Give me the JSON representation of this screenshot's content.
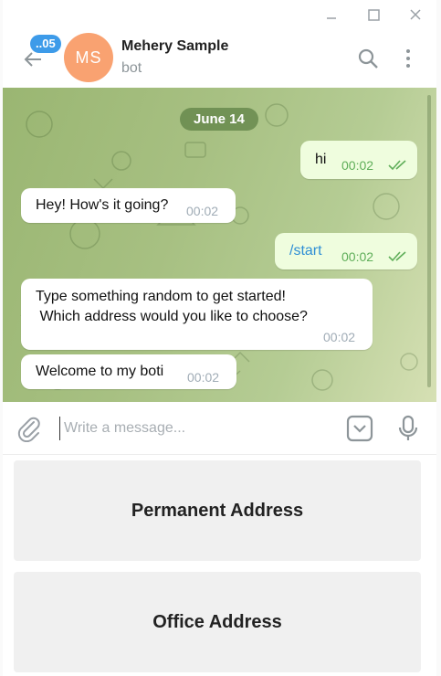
{
  "window": {
    "controls": {
      "minimize_icon": "minimize-icon",
      "maximize_icon": "maximize-icon",
      "close_icon": "close-icon"
    }
  },
  "header": {
    "unread_count": "..05",
    "avatar_initials": "MS",
    "avatar_color": "#f9a271",
    "title": "Mehery Sample",
    "status": "bot"
  },
  "chat": {
    "date": "June 14",
    "messages": [
      {
        "direction": "out",
        "text": "hi",
        "time": "00:02",
        "read": true
      },
      {
        "direction": "in",
        "text": "Hey! How's it going?",
        "time": "00:02"
      },
      {
        "direction": "out",
        "text": "/start",
        "time": "00:02",
        "read": true
      },
      {
        "direction": "in",
        "line1": "Type something random to get started!",
        "line2": " Which address would you like to choose?",
        "time": "00:02"
      },
      {
        "direction": "in",
        "text": "Welcome to my boti",
        "time": "00:02"
      }
    ]
  },
  "composer": {
    "placeholder": "Write a message..."
  },
  "reply_keyboard": {
    "buttons": [
      "Permanent Address",
      "Office Address"
    ]
  },
  "colors": {
    "accent": "#3d9be9",
    "outgoing_bubble": "#effdde",
    "read_ticks": "#5fae59",
    "chat_background": "#a7c082"
  }
}
